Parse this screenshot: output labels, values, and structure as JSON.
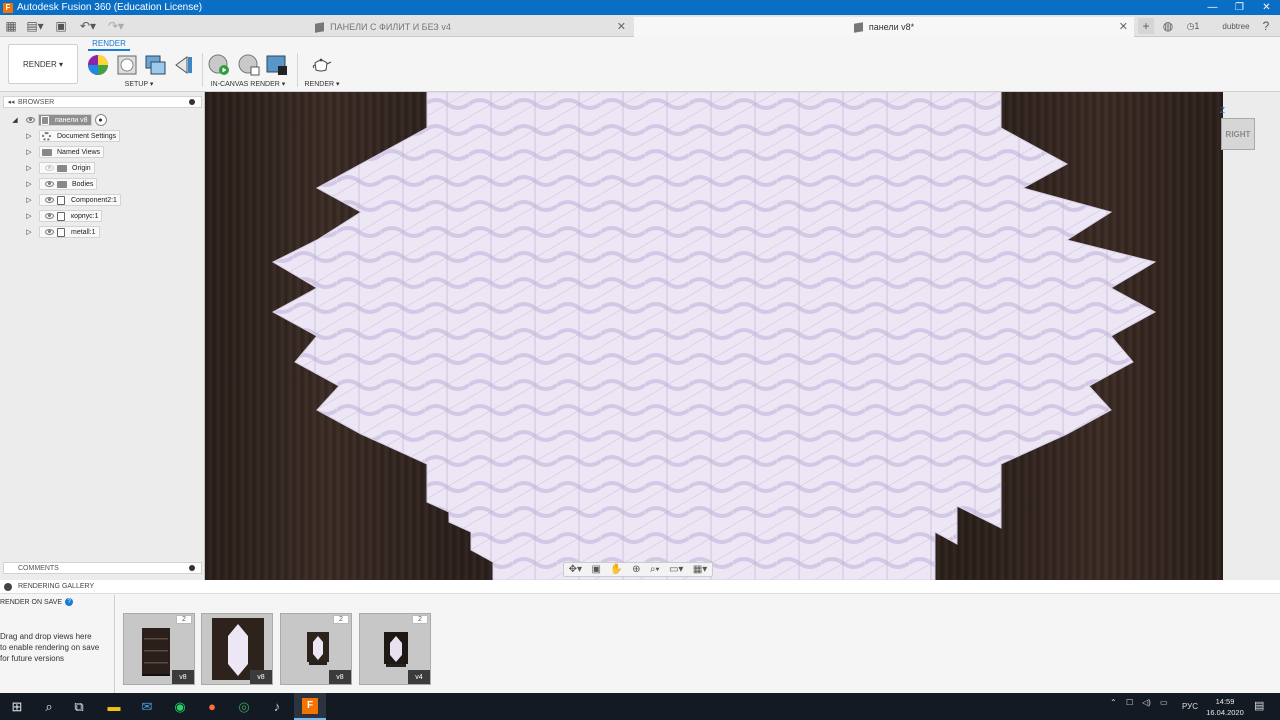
{
  "titlebar": {
    "title": "Autodesk Fusion 360 (Education License)",
    "app_badge": "F",
    "minimize": "—",
    "maximize": "❐",
    "close": "✕"
  },
  "tabs": [
    {
      "label": "ПАНЕЛИ С ФИЛИТ И БЕЗ v4",
      "active": false
    },
    {
      "label": "панели v8*",
      "active": true
    }
  ],
  "tabbar": {
    "jobs_count": "1",
    "user": "dubtree"
  },
  "ribbon": {
    "workspace": "RENDER ▾",
    "tab": "RENDER",
    "groups": {
      "setup": "SETUP ▾",
      "incanvas": "IN-CANVAS RENDER ▾",
      "render": "RENDER ▾"
    }
  },
  "browser": {
    "title": "BROWSER",
    "root": "панели v8",
    "items": [
      "Document Settings",
      "Named Views",
      "Origin",
      "Bodies",
      "Component2:1",
      "корпус:1",
      "metall:1"
    ]
  },
  "comments": {
    "title": "COMMENTS"
  },
  "viewcube": {
    "face": "RIGHT",
    "axis_z": "Z"
  },
  "gallery": {
    "title": "RENDERING GALLERY",
    "render_on_save": "RENDER ON SAVE",
    "hint": [
      "Drag and drop views here",
      "to enable rendering on save",
      "for future versions"
    ],
    "thumbnails": [
      {
        "count": "2",
        "version": "v8"
      },
      {
        "count": "",
        "version": "v8"
      },
      {
        "count": "2",
        "version": "v8"
      },
      {
        "count": "2",
        "version": "v4"
      }
    ]
  },
  "taskbar": {
    "lang": "РУС",
    "time": "14:59",
    "date": "16.04.2020"
  },
  "colors": {
    "accent": "#1b7ad1",
    "titlebar": "#0a6fc4",
    "panel_fill": "#ece6f5",
    "taskbar": "#141a24"
  }
}
